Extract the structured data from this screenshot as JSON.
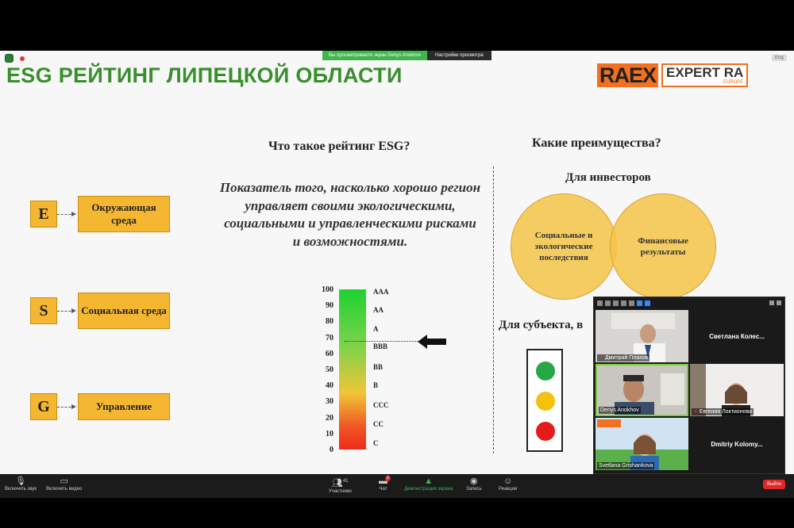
{
  "share": {
    "text": "Вы просматриваете экран Denys Anokhov",
    "settings": "Настройки просмотра"
  },
  "slide": {
    "title": "ESG РЕЙТИНГ ЛИПЕЦКОЙ ОБЛАСТИ",
    "logo": {
      "raex": "RAEX",
      "expert": "EXPERT RA",
      "europe": "EUROPE"
    },
    "eng": "Eng",
    "esg_items": [
      {
        "letter": "E",
        "label": "Окружающая среда"
      },
      {
        "letter": "S",
        "label": "Социальная среда"
      },
      {
        "letter": "G",
        "label": "Управление"
      }
    ],
    "question1": "Что такое рейтинг ESG?",
    "definition": "Показатель того, насколько хорошо регион управляет своими экологическими, социальными и управленческими рисками и возможностями.",
    "scale_ticks": [
      "100",
      "90",
      "80",
      "70",
      "60",
      "50",
      "40",
      "30",
      "20",
      "10",
      "0"
    ],
    "grades": [
      "AAA",
      "AA",
      "A",
      "BBB",
      "BB",
      "B",
      "CCC",
      "CC",
      "C"
    ],
    "question2": "Какие преимущества?",
    "for_investors": "Для инвесторов",
    "circle_left": "Социальные и экологические последствия",
    "circle_right": "Финансовые результаты",
    "for_subject": "Для субъекта, в",
    "traffic_colors": {
      "green": "#28a745",
      "yellow": "#f4c20d",
      "red": "#e51c1c"
    }
  },
  "participants": [
    {
      "name": "Дмитрий Плахов"
    },
    {
      "name": "Светлана Колес..."
    },
    {
      "name": "Denys Anokhov"
    },
    {
      "name": "Евгения Локтионова"
    },
    {
      "name": "Svetlana Grishankova"
    },
    {
      "name": "Dmitriy Kolomy..."
    }
  ],
  "toolbar": {
    "mute": "Включить звук",
    "video": "Включить видео",
    "participants": "Участники",
    "participants_count": "41",
    "chat": "Чат",
    "chat_badge": "2",
    "share": "Демонстрация экрана",
    "record": "Запись",
    "reactions": "Реакции",
    "leave": "Выйти"
  }
}
